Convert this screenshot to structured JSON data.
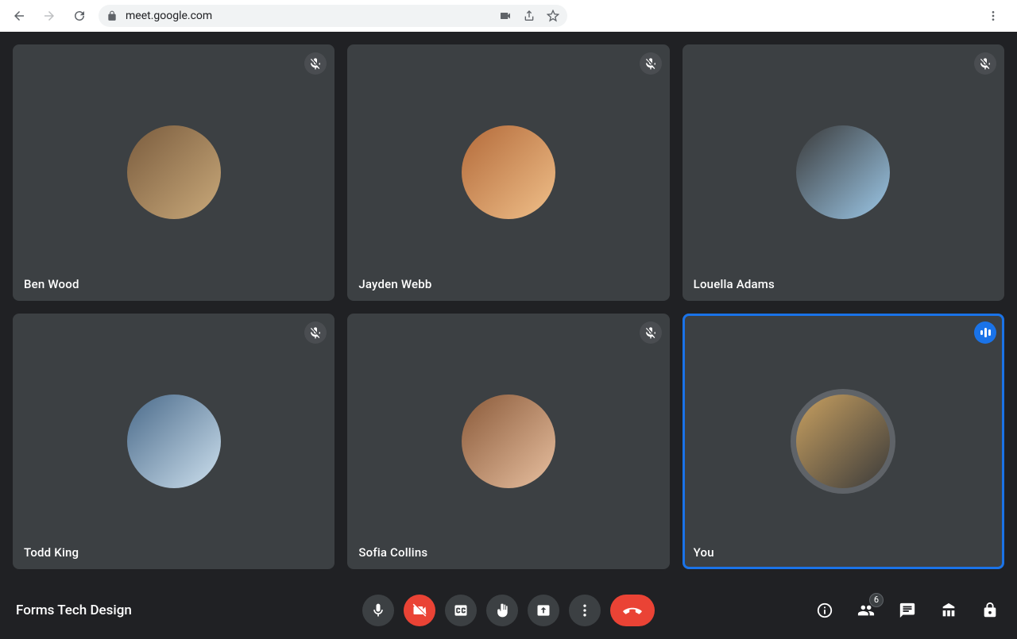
{
  "browser": {
    "url": "meet.google.com"
  },
  "participants": [
    {
      "name": "Ben Wood",
      "muted": true,
      "active": false
    },
    {
      "name": "Jayden Webb",
      "muted": true,
      "active": false
    },
    {
      "name": "Louella Adams",
      "muted": true,
      "active": false
    },
    {
      "name": "Todd King",
      "muted": true,
      "active": false
    },
    {
      "name": "Sofia Collins",
      "muted": true,
      "active": false
    },
    {
      "name": "You",
      "muted": false,
      "active": true,
      "speaking": true
    }
  ],
  "meeting": {
    "title": "Forms Tech Design",
    "participant_count": "6"
  },
  "controls": {
    "mic_muted": false,
    "camera_off": true
  },
  "colors": {
    "bg": "#202124",
    "tile": "#3c4043",
    "accent": "#1a73e8",
    "danger": "#ea4335"
  }
}
